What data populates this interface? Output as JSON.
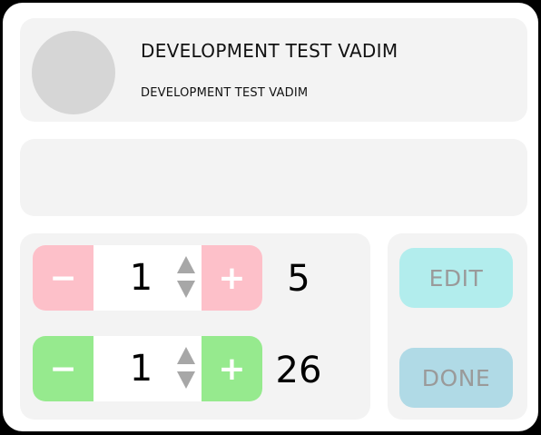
{
  "profile": {
    "name": "DEVELOPMENT TEST VADIM",
    "subtitle": "DEVELOPMENT TEST VADIM"
  },
  "steppers": [
    {
      "color": "#fdc0c9",
      "minus_label": "−",
      "plus_label": "+",
      "value": "1",
      "total": "5"
    },
    {
      "color": "#96ea8e",
      "minus_label": "−",
      "plus_label": "+",
      "value": "1",
      "total": "26"
    }
  ],
  "actions": {
    "edit_label": "EDIT",
    "done_label": "DONE",
    "edit_color": "#b2eded",
    "done_color": "#b0dae6"
  }
}
